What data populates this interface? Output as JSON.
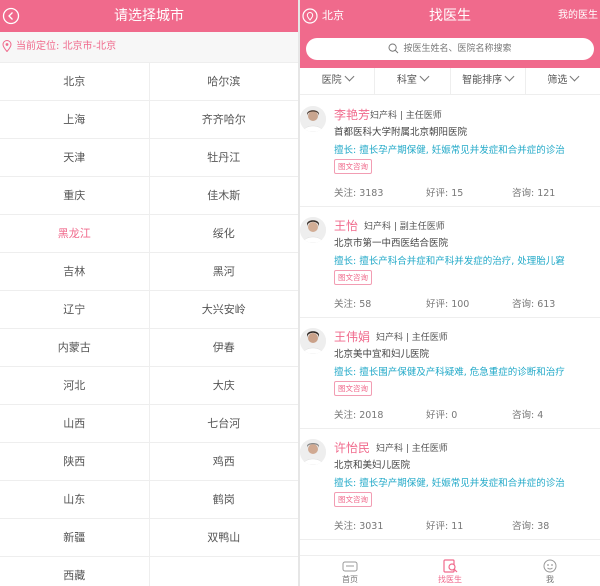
{
  "left": {
    "header": {
      "title": "请选择城市"
    },
    "current_location": {
      "label": "当前定位:",
      "value": "北京市-北京"
    },
    "cities": [
      [
        "北京",
        "哈尔滨"
      ],
      [
        "上海",
        "齐齐哈尔"
      ],
      [
        "天津",
        "牡丹江"
      ],
      [
        "重庆",
        "佳木斯"
      ],
      [
        "黑龙江",
        "绥化"
      ],
      [
        "吉林",
        "黑河"
      ],
      [
        "辽宁",
        "大兴安岭"
      ],
      [
        "内蒙古",
        "伊春"
      ],
      [
        "河北",
        "大庆"
      ],
      [
        "山西",
        "七台河"
      ],
      [
        "陕西",
        "鸡西"
      ],
      [
        "山东",
        "鹤岗"
      ],
      [
        "新疆",
        "双鸭山"
      ],
      [
        "西藏",
        ""
      ]
    ],
    "active_city": "黑龙江"
  },
  "right": {
    "header": {
      "city": "北京",
      "title": "找医生",
      "my": "我的医生"
    },
    "search": {
      "placeholder": "按医生姓名、医院名称搜索"
    },
    "filters": [
      "医院",
      "科室",
      "智能排序",
      "筛选"
    ],
    "doctors": [
      {
        "name": "李艳芳",
        "dept": "妇产科 | 主任医师",
        "hospital": "首都医科大学附属北京朝阳医院",
        "specialty": "擅长: 擅长孕产期保健, 妊娠常见并发症和合并症的诊治",
        "tag": "图文咨询",
        "stats": [
          "关注: 3183",
          "好评: 15",
          "咨询: 121"
        ]
      },
      {
        "name": "王怡",
        "dept": "妇产科 | 副主任医师",
        "hospital": "北京市第一中西医结合医院",
        "specialty": "擅长: 擅长产科合并症和产科并发症的治疗, 处理胎儿窘",
        "tag": "图文咨询",
        "stats": [
          "关注: 58",
          "好评: 100",
          "咨询: 613"
        ]
      },
      {
        "name": "王伟娟",
        "dept": "妇产科 | 主任医师",
        "hospital": "北京美中宜和妇儿医院",
        "specialty": "擅长: 擅长围产保健及产科疑难, 危急重症的诊断和治疗",
        "tag": "图文咨询",
        "stats": [
          "关注: 2018",
          "好评: 0",
          "咨询: 4"
        ]
      },
      {
        "name": "许怡民",
        "dept": "妇产科 | 主任医师",
        "hospital": "北京和美妇儿医院",
        "specialty": "擅长: 擅长孕产期保健, 妊娠常见并发症和合并症的诊治",
        "tag": "图文咨询",
        "stats": [
          "关注: 3031",
          "好评: 11",
          "咨询: 38"
        ]
      }
    ],
    "tabs": [
      {
        "label": "首页",
        "icon": "home-icon"
      },
      {
        "label": "找医生",
        "icon": "find-doctor-icon"
      },
      {
        "label": "我",
        "icon": "me-icon"
      }
    ]
  },
  "colors": {
    "accent": "#f06a8c",
    "link": "#22a9c8"
  }
}
